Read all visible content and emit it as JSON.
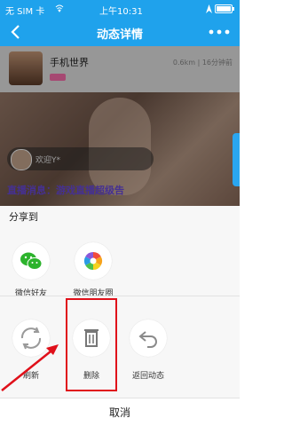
{
  "status_bar": {
    "carrier": "无 SIM 卡",
    "time": "上午10:31"
  },
  "nav": {
    "title": "动态详情"
  },
  "post": {
    "user_name": "手机世界",
    "meta": "0.6km | 16分钟前",
    "chat_text": "欢迎Y*",
    "broadcast_text": "直播消息：游戏直播超级告"
  },
  "share_sheet": {
    "title": "分享到",
    "share_options": [
      {
        "label": "微信好友",
        "icon": "wechat-icon"
      },
      {
        "label": "微信朋友圈",
        "icon": "moments-icon"
      }
    ],
    "action_options": [
      {
        "label": "刷新",
        "icon": "refresh-icon"
      },
      {
        "label": "删除",
        "icon": "trash-icon"
      },
      {
        "label": "返回动态",
        "icon": "return-icon"
      }
    ],
    "cancel_label": "取消"
  },
  "colors": {
    "primary": "#1fa2ec",
    "wechat_green": "#2cb32c",
    "highlight_red": "#e0101a",
    "broadcast_text": "#6a4be0"
  }
}
